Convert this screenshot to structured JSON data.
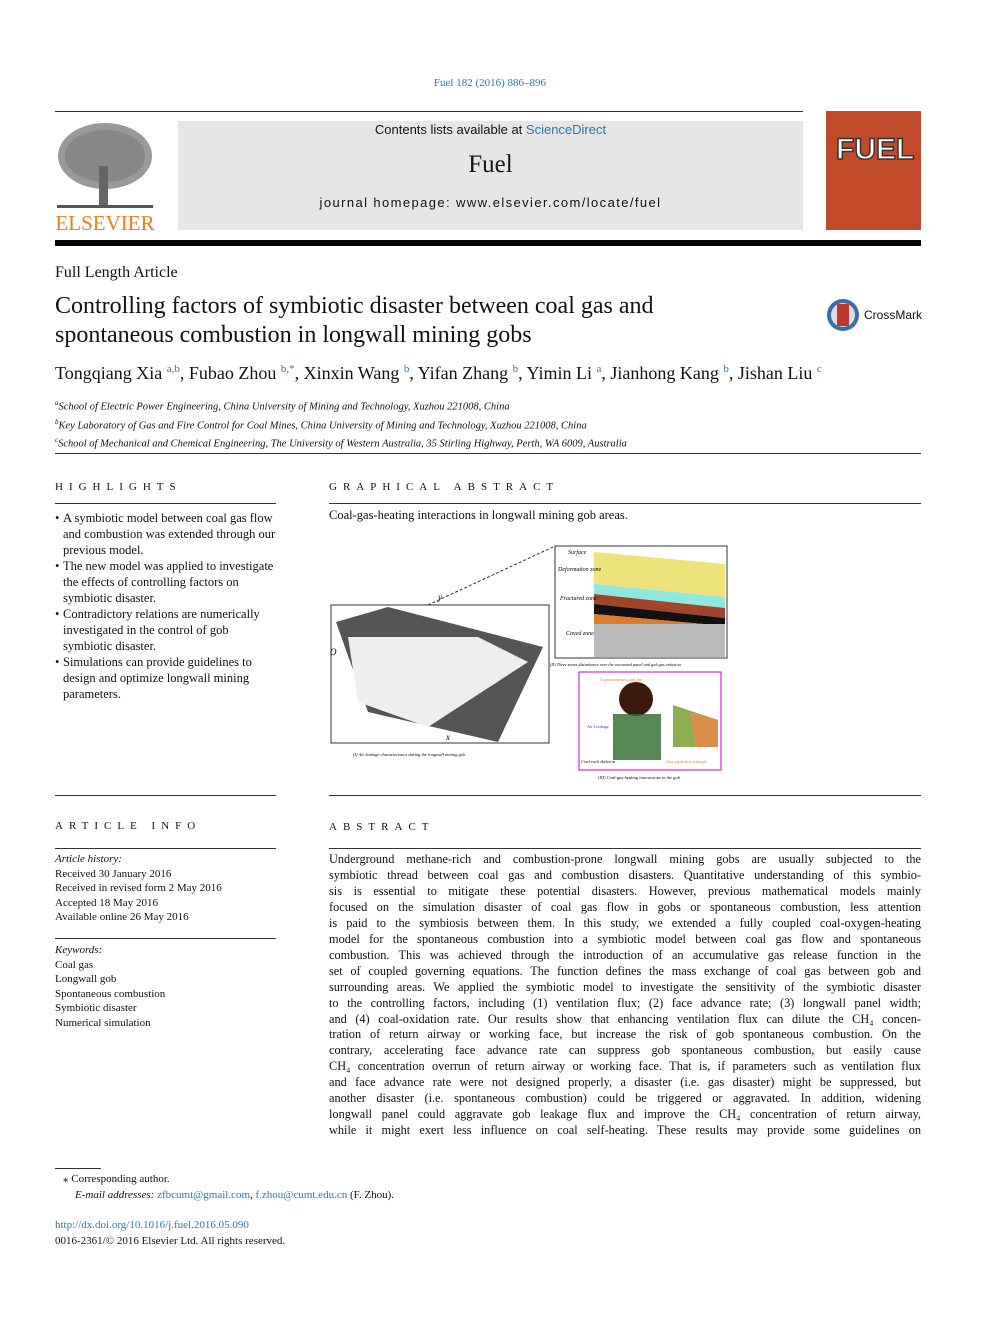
{
  "header": {
    "citation": "Fuel 182 (2016) 886–896",
    "contents_prefix": "Contents lists available at ",
    "contents_link": "ScienceDirect",
    "journal": "Fuel",
    "homepage": "journal homepage: www.elsevier.com/locate/fuel",
    "publisher_logo": "ELSEVIER",
    "cover_title": "FUEL"
  },
  "article": {
    "type": "Full Length Article",
    "title_lines": [
      "Controlling factors of symbiotic disaster between coal gas and",
      "spontaneous combustion in longwall mining gobs"
    ],
    "crossmark": "CrossMark",
    "authors": [
      {
        "name": "Tongqiang Xia",
        "sup": "a,b"
      },
      {
        "name": "Fubao Zhou",
        "sup": "b,*"
      },
      {
        "name": "Xinxin Wang",
        "sup": "b"
      },
      {
        "name": "Yifan Zhang",
        "sup": "b"
      },
      {
        "name": "Yimin Li",
        "sup": "a"
      },
      {
        "name": "Jianhong Kang",
        "sup": "b"
      },
      {
        "name": "Jishan Liu",
        "sup": "c"
      }
    ],
    "affiliations": [
      {
        "sup": "a",
        "text": "School of Electric Power Engineering, China University of Mining and Technology, Xuzhou 221008, China"
      },
      {
        "sup": "b",
        "text": "Key Laboratory of Gas and Fire Control for Coal Mines, China University of Mining and Technology, Xuzhou 221008, China"
      },
      {
        "sup": "c",
        "text": "School of Mechanical and Chemical Engineering, The University of Western Australia, 35 Stirling Highway, Perth, WA 6009, Australia"
      }
    ]
  },
  "highlights": {
    "heading": "HIGHLIGHTS",
    "items": [
      "A symbiotic model between coal gas flow and combustion was extended through our previous model.",
      "The new model was applied to investigate the effects of controlling factors on symbiotic disaster.",
      "Contradictory relations are numerically investigated in the control of gob symbiotic disaster.",
      "Simulations can provide guidelines to design and optimize longwall mining parameters."
    ]
  },
  "graphical_abstract": {
    "heading": "GRAPHICAL ABSTRACT",
    "text": "Coal-gas-heating interactions in longwall mining gob areas.",
    "fig_labels": {
      "surface": "Surface",
      "deformation": "Deformation zone",
      "fractured": "Fractured zone",
      "caved": "Caved zone",
      "caption1": "(I) Air leakage characteristics during the longwall mining gob",
      "caption2": "(II) Three zones disturbance over the excavated panel and gob gas emission",
      "caption3": "(III) Coal-gas-heating interactions in the gob",
      "fire": "A spontaneous coal fire",
      "air": "Air",
      "methane": "Methane",
      "air_leakage": "Air Leakage",
      "skeleton": "Coal-rock skeleton",
      "fractures": "Fractures",
      "triangle": "Gas explosion triangle",
      "y": "y",
      "x": "x",
      "o": "O"
    }
  },
  "article_info": {
    "heading": "ARTICLE INFO",
    "history_label": "Article history:",
    "history": [
      "Received 30 January 2016",
      "Received in revised form 2 May 2016",
      "Accepted 18 May 2016",
      "Available online 26 May 2016"
    ],
    "keywords_label": "Keywords:",
    "keywords": [
      "Coal gas",
      "Longwall gob",
      "Spontaneous combustion",
      "Symbiotic disaster",
      "Numerical simulation"
    ]
  },
  "abstract": {
    "heading": "ABSTRACT",
    "lines": [
      "Underground methane-rich and combustion-prone longwall mining gobs are usually subjected to the",
      "symbiotic thread between coal gas and combustion disasters. Quantitative understanding of this symbio-",
      "sis is essential to mitigate these potential disasters. However, previous mathematical models mainly",
      "focused on the simulation disaster of coal gas flow in gobs or spontaneous combustion, less attention",
      "is paid to the symbiosis between them. In this study, we extended a fully coupled coal-oxygen-heating",
      "model for the spontaneous combustion into a symbiotic model between coal gas flow and spontaneous",
      "combustion. This was achieved through the introduction of an accumulative gas release function in the",
      "set of coupled governing equations. The function defines the mass exchange of coal gas between gob and",
      "surrounding areas. We applied the symbiotic model to investigate the sensitivity of the symbiotic disaster",
      "to the controlling factors, including (1) ventilation flux; (2) face advance rate; (3) longwall panel width;",
      "and (4) coal-oxidation rate. Our results show that enhancing ventilation flux can dilute the CH₄ concen-",
      "tration of return airway or working face, but increase the risk of gob spontaneous combustion. On the",
      "contrary, accelerating face advance rate can suppress gob spontaneous combustion, but easily cause",
      "CH₄ concentration overrun of return airway or working face. That is, if parameters such as ventilation flux",
      "and face advance rate were not designed properly, a disaster (i.e. gas disaster) might be suppressed, but",
      "another disaster (i.e. spontaneous combustion) could be triggered or aggravated. In addition, widening",
      "longwall panel could aggravate gob leakage flux and improve the CH₄ concentration of return airway,",
      "while it might exert less influence on coal self-heating. These results may provide some guidelines on"
    ]
  },
  "footer": {
    "corresponding": "⁎ Corresponding author.",
    "email_label": "E-mail addresses: ",
    "email1": "zfbcumt@gmail.com",
    "sep": ", ",
    "email2": "f.zhou@cumt.edu.cn",
    "email_suffix": " (F. Zhou).",
    "doi": "http://dx.doi.org/10.1016/j.fuel.2016.05.090",
    "copyright": "0016-2361/© 2016 Elsevier Ltd. All rights reserved."
  },
  "colors": {
    "link": "#2a7ab0",
    "elsevier_orange": "#f07d1a",
    "cover": "#c14a2a",
    "banner": "#e6e6e6"
  }
}
